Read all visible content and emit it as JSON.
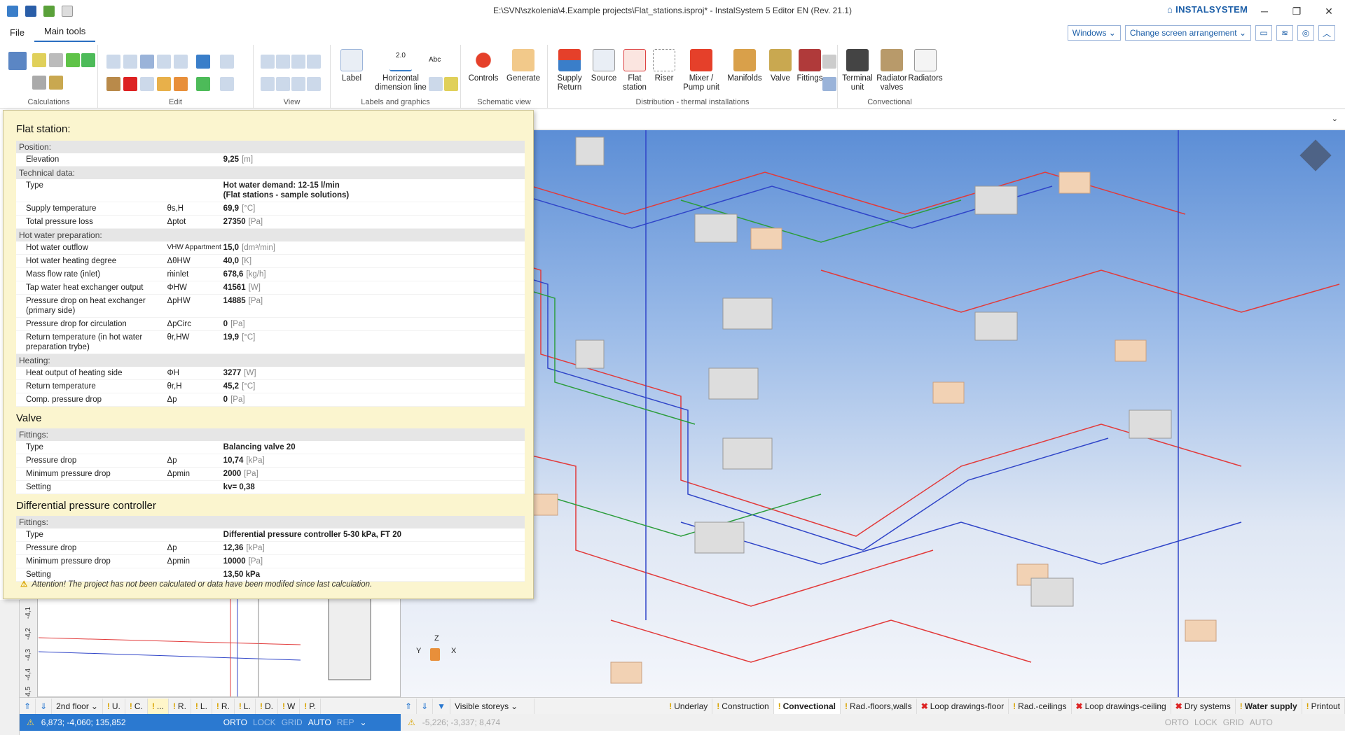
{
  "window": {
    "title": "E:\\SVN\\szkolenia\\4.Example projects\\Flat_stations.isproj* - InstalSystem 5 Editor EN (Rev. 21.1)",
    "brand": "INSTALSYSTEM"
  },
  "menu": {
    "file": "File",
    "main_tools": "Main tools"
  },
  "menu_right": {
    "windows": "Windows",
    "arrangement": "Change screen arrangement"
  },
  "ribbon": {
    "groups": {
      "calculations": "Calculations",
      "edit": "Edit",
      "view": "View",
      "labels": "Labels and graphics",
      "schematic": "Schematic view",
      "distribution": "Distribution - thermal installations",
      "convectional": "Convectional"
    },
    "buttons": {
      "label": "Label",
      "hdim1": "Horizontal",
      "hdim2": "dimension line",
      "hdim_value": "2.0",
      "abc": "Abc",
      "controls": "Controls",
      "generate": "Generate",
      "supply1": "Supply",
      "supply2": "Return",
      "source": "Source",
      "flat1": "Flat",
      "flat2": "station",
      "riser": "Riser",
      "mixer1": "Mixer /",
      "mixer2": "Pump unit",
      "manifolds": "Manifolds",
      "valve": "Valve",
      "fittings": "Fittings",
      "terminal1": "Terminal",
      "terminal2": "unit",
      "radvalves1": "Radiator",
      "radvalves2": "valves",
      "radiators": "Radiators"
    }
  },
  "tooltip": {
    "flat_title": "Flat station:",
    "position": "Position:",
    "elevation": {
      "name": "Elevation",
      "value": "9,25",
      "unit": "[m]"
    },
    "technical": "Technical data:",
    "type": {
      "name": "Type",
      "value1": "Hot water demand: 12-15 l/min",
      "value2": "(Flat stations - sample solutions)"
    },
    "supply_temp": {
      "name": "Supply temperature",
      "sym": "θs,H",
      "value": "69,9",
      "unit": "[°C]"
    },
    "total_loss": {
      "name": "Total pressure loss",
      "sym": "Δptot",
      "value": "27350",
      "unit": "[Pa]"
    },
    "hw_prep": "Hot water preparation:",
    "hw_outflow": {
      "name": "Hot water outflow",
      "sym": "VHW Appartment",
      "value": "15,0",
      "unit": "[dm³/min]"
    },
    "hw_degree": {
      "name": "Hot water heating degree",
      "sym": "ΔθHW",
      "value": "40,0",
      "unit": "[K]"
    },
    "mass_flow": {
      "name": "Mass flow rate (inlet)",
      "sym": "ṁinlet",
      "value": "678,6",
      "unit": "[kg/h]"
    },
    "tap_output": {
      "name": "Tap water heat exchanger output",
      "sym": "ΦHW",
      "value": "41561",
      "unit": "[W]"
    },
    "pdrop_hx": {
      "name1": "Pressure drop on heat exchanger",
      "name2": "(primary side)",
      "sym": "ΔpHW",
      "value": "14885",
      "unit": "[Pa]"
    },
    "pdrop_circ": {
      "name": "Pressure drop for circulation",
      "sym": "ΔpCirc",
      "value": "0",
      "unit": "[Pa]"
    },
    "ret_temp_hw": {
      "name1": "Return temperature (in hot water",
      "name2": "preparation trybe)",
      "sym": "θr,HW",
      "value": "19,9",
      "unit": "[°C]"
    },
    "heating": "Heating:",
    "heat_output": {
      "name": "Heat output of heating side",
      "sym": "ΦH",
      "value": "3277",
      "unit": "[W]"
    },
    "ret_temp": {
      "name": "Return temperature",
      "sym": "θr,H",
      "value": "45,2",
      "unit": "[°C]"
    },
    "comp_drop": {
      "name": "Comp. pressure drop",
      "sym": "Δp",
      "value": "0",
      "unit": "[Pa]"
    },
    "valve_title": "Valve",
    "fittings": "Fittings:",
    "v_type": {
      "name": "Type",
      "value": "Balancing valve 20"
    },
    "v_pdrop": {
      "name": "Pressure drop",
      "sym": "Δp",
      "value": "10,74",
      "unit": "[kPa]"
    },
    "v_minpd": {
      "name": "Minimum pressure drop",
      "sym": "Δpmin",
      "value": "2000",
      "unit": "[Pa]"
    },
    "v_setting": {
      "name": "Setting",
      "value": "kv= 0,38"
    },
    "dpc_title": "Differential pressure controller",
    "d_type": {
      "name": "Type",
      "value": "Differential pressure controller 5-30 kPa, FT 20"
    },
    "d_pdrop": {
      "name": "Pressure drop",
      "sym": "Δp",
      "value": "12,36",
      "unit": "[kPa]"
    },
    "d_minpd": {
      "name": "Minimum pressure drop",
      "sym": "Δpmin",
      "value": "10000",
      "unit": "[Pa]"
    },
    "d_setting": {
      "name": "Setting",
      "value": "13,50 kPa"
    },
    "warning": "Attention! The project has not been calculated or data have been modifed since last calculation."
  },
  "ruler": [
    "-4,1",
    "-4,2",
    "-4,3",
    "-4,4",
    "-4,5"
  ],
  "axes": {
    "x": "X",
    "y": "Y",
    "z": "Z"
  },
  "left_tabs": [
    "2nd floor",
    "U.",
    "C.",
    "...",
    "R.",
    "L.",
    "R.",
    "L.",
    "D.",
    "W",
    "P."
  ],
  "right_tabs": {
    "storeys": "Visible storeys",
    "layers": [
      "Underlay",
      "Construction",
      "Convectional",
      "Rad.-floors,walls",
      "Loop drawings-floor",
      "Rad.-ceilings",
      "Loop drawings-ceiling",
      "Dry systems",
      "Water supply",
      "Printout"
    ]
  },
  "status_left": {
    "coords": "6,873; -4,060; 135,852",
    "orto": "ORTO",
    "lock": "LOCK",
    "grid": "GRID",
    "auto": "AUTO",
    "rep": "REP"
  },
  "status_right": {
    "coords": "-5,226; -3,337; 8,474",
    "orto": "ORTO",
    "lock": "LOCK",
    "grid": "GRID",
    "auto": "AUTO"
  }
}
